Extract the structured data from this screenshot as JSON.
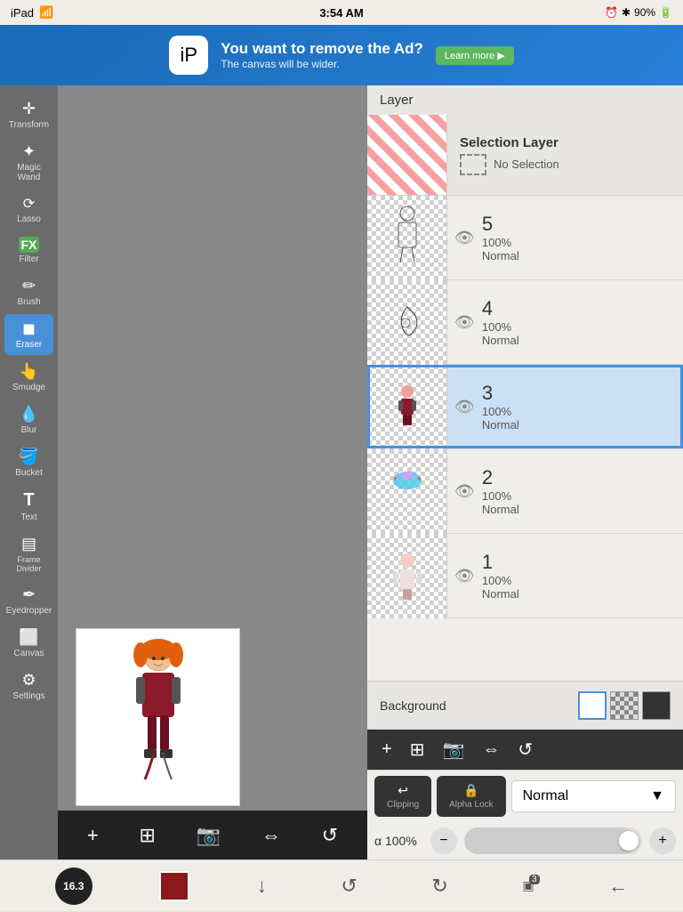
{
  "statusBar": {
    "left": "iPad",
    "wifi": "wifi",
    "time": "3:54 AM",
    "batteryIcon": "alarm-icon",
    "bluetooth": "bluetooth",
    "battery": "90%"
  },
  "ad": {
    "logo": "iP",
    "title": "You want to remove the Ad?",
    "subtitle": "The canvas will be wider.",
    "learnMore": "Learn more ▶"
  },
  "leftToolbar": {
    "tools": [
      {
        "id": "transform",
        "icon": "⊕",
        "label": "Transform"
      },
      {
        "id": "magic-wand",
        "icon": "✦",
        "label": "Magic Wand"
      },
      {
        "id": "lasso",
        "icon": "⌾",
        "label": "Lasso"
      },
      {
        "id": "filter",
        "icon": "FX",
        "label": "Filter"
      },
      {
        "id": "brush",
        "icon": "✏",
        "label": "Brush"
      },
      {
        "id": "eraser",
        "icon": "◼",
        "label": "Eraser",
        "active": true
      },
      {
        "id": "smudge",
        "icon": "☁",
        "label": "Smudge"
      },
      {
        "id": "blur",
        "icon": "◉",
        "label": "Blur"
      },
      {
        "id": "bucket",
        "icon": "⬡",
        "label": "Bucket"
      },
      {
        "id": "text",
        "icon": "T",
        "label": "Text"
      },
      {
        "id": "frame-divider",
        "icon": "▤",
        "label": "Frame Divider"
      },
      {
        "id": "eyedropper",
        "icon": "✒",
        "label": "Eyedropper"
      },
      {
        "id": "canvas",
        "icon": "▢",
        "label": "Canvas"
      },
      {
        "id": "settings",
        "icon": "⚙",
        "label": "Settings"
      }
    ]
  },
  "layersPanel": {
    "title": "Layer",
    "selectionLayer": {
      "title": "Selection Layer",
      "noSelection": "No Selection"
    },
    "layers": [
      {
        "id": 5,
        "number": "5",
        "opacity": "100%",
        "mode": "Normal",
        "visible": true,
        "selected": false,
        "content": "sketch"
      },
      {
        "id": 4,
        "number": "4",
        "opacity": "100%",
        "mode": "Normal",
        "visible": true,
        "selected": false,
        "content": "sketch2"
      },
      {
        "id": 3,
        "number": "3",
        "opacity": "100%",
        "mode": "Normal",
        "visible": true,
        "selected": true,
        "content": "figure"
      },
      {
        "id": 2,
        "number": "2",
        "opacity": "100%",
        "mode": "Normal",
        "visible": true,
        "selected": false,
        "content": "hair"
      },
      {
        "id": 1,
        "number": "1",
        "opacity": "100%",
        "mode": "Normal",
        "visible": true,
        "selected": false,
        "content": "base"
      }
    ],
    "background": {
      "label": "Background"
    }
  },
  "bottomPanel": {
    "clippingLabel": "Clipping",
    "alphaLockLabel": "Alpha Lock",
    "blendMode": "Normal",
    "opacityLabel": "α 100%"
  },
  "addLayerToolbar": {
    "buttons": [
      "+",
      "⊞",
      "📷",
      "↔",
      "⟳"
    ]
  },
  "rightActionBar": {
    "buttons": [
      "⊠",
      "⊟",
      "✛",
      "↩",
      "↪",
      "⬇",
      "🗑",
      "⋮"
    ]
  },
  "bottomNav": {
    "brushSize": "16.3",
    "layerCount": "3"
  }
}
